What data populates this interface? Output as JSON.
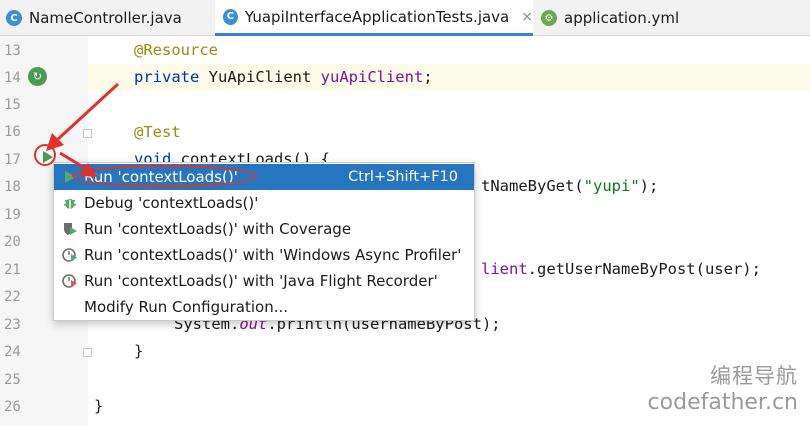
{
  "tabs": [
    {
      "label": "NameController.java",
      "icon": "java-class-icon",
      "active": false
    },
    {
      "label": "YuapiInterfaceApplicationTests.java",
      "icon": "java-class-icon",
      "active": true,
      "close": "×"
    },
    {
      "label": "application.yml",
      "icon": "yml-file-icon",
      "active": false
    }
  ],
  "editor": {
    "line_numbers": [
      "13",
      "14",
      "15",
      "16",
      "17",
      "18",
      "19",
      "20",
      "21",
      "22",
      "23",
      "24",
      "25",
      "26"
    ],
    "lines": {
      "l13": {
        "anno": "@Resource"
      },
      "l14": {
        "kw": "private",
        "type": " YuApiClient ",
        "field": "yuApiClient",
        "end": ";"
      },
      "l16": {
        "anno": "@Test"
      },
      "l17": {
        "kw": "void",
        "rest": " contextLoads() {"
      },
      "l18": {
        "pre": "tNameByGet(",
        "str": "\"yupi\"",
        "end": ");"
      },
      "l21": {
        "fld": "lient",
        "rest": ".getUserNameByPost(user);"
      },
      "l23": {
        "pre": "System.",
        "ital": "out",
        "rest": ".println(usernameByPost);"
      },
      "l24": {
        "text": "}"
      },
      "l26": {
        "text": "}"
      }
    }
  },
  "popup_menu": {
    "items": [
      {
        "label": "Run 'contextLoads()'",
        "shortcut": "Ctrl+Shift+F10",
        "icon": "run-icon"
      },
      {
        "label": "Debug 'contextLoads()'",
        "icon": "debug-icon"
      },
      {
        "label": "Run 'contextLoads()' with Coverage",
        "icon": "coverage-icon"
      },
      {
        "label": "Run 'contextLoads()' with 'Windows Async Profiler'",
        "icon": "profiler-icon"
      },
      {
        "label": "Run 'contextLoads()' with 'Java Flight Recorder'",
        "icon": "flight-recorder-icon"
      },
      {
        "label": "Modify Run Configuration...",
        "icon": ""
      }
    ]
  },
  "watermark": {
    "line1": "编程导航",
    "line2": "codefather.cn"
  },
  "colors": {
    "selection": "#2675bf",
    "annotation_red": "#e0312b",
    "keyword": "#0033b3",
    "annotation": "#9e880d",
    "string": "#067d17"
  }
}
